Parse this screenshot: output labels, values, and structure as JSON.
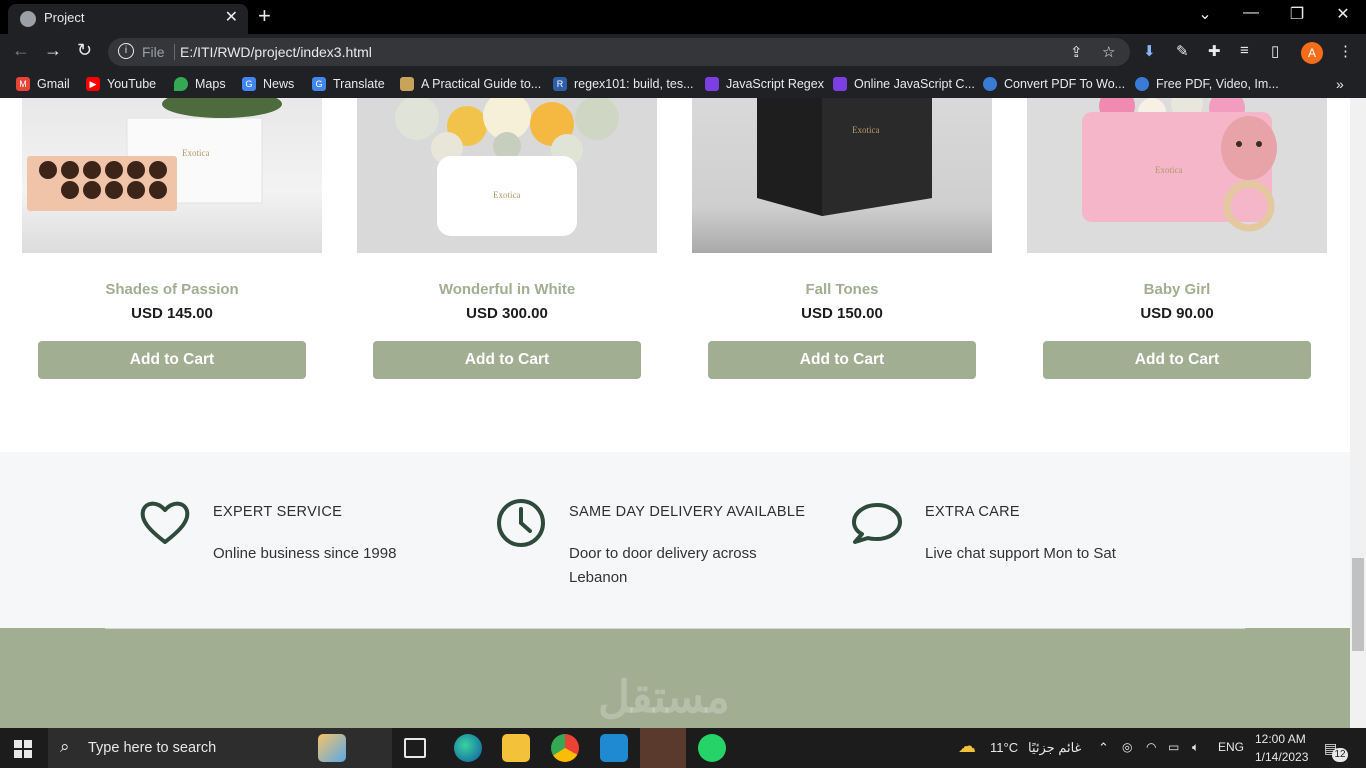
{
  "browser": {
    "tab_title": "Project",
    "url_scheme": "File",
    "url": "E:/ITI/RWD/project/index3.html",
    "profile_initial": "A",
    "bookmarks": [
      {
        "label": "Gmail",
        "icon": "gmail-icon",
        "color": "#ea4335"
      },
      {
        "label": "YouTube",
        "icon": "youtube-icon",
        "color": "#ff0000"
      },
      {
        "label": "Maps",
        "icon": "maps-icon",
        "color": "#34a853"
      },
      {
        "label": "News",
        "icon": "news-icon",
        "color": "#4285f4"
      },
      {
        "label": "Translate",
        "icon": "translate-icon",
        "color": "#4285f4"
      },
      {
        "label": "A Practical Guide to...",
        "icon": "guide-icon",
        "color": "#c8a35a"
      },
      {
        "label": "regex101: build, tes...",
        "icon": "regex101-icon",
        "color": "#2f5ea8"
      },
      {
        "label": "JavaScript Regex",
        "icon": "js-regex-icon",
        "color": "#7b3fe4"
      },
      {
        "label": "Online JavaScript C...",
        "icon": "online-js-icon",
        "color": "#7b3fe4"
      },
      {
        "label": "Convert PDF To Wo...",
        "icon": "pdf-icon",
        "color": "#3a7bd5"
      },
      {
        "label": "Free PDF, Video, Im...",
        "icon": "free-pdf-icon",
        "color": "#3a7bd5"
      }
    ]
  },
  "products": [
    {
      "name": "Shades of Passion",
      "price": "USD 145.00",
      "button": "Add to Cart"
    },
    {
      "name": "Wonderful in White",
      "price": "USD 300.00",
      "button": "Add to Cart"
    },
    {
      "name": "Fall Tones",
      "price": "USD 150.00",
      "button": "Add to Cart"
    },
    {
      "name": "Baby Girl",
      "price": "USD 90.00",
      "button": "Add to Cart"
    }
  ],
  "image_text": {
    "brand_on_box": "Exotica"
  },
  "features": [
    {
      "title": "EXPERT SERVICE",
      "desc": "Online business since 1998",
      "icon": "heart-icon"
    },
    {
      "title": "SAME DAY DELIVERY AVAILABLE",
      "desc": "Door to door delivery across Lebanon",
      "icon": "clock-icon"
    },
    {
      "title": "EXTRA CARE",
      "desc": "Live chat support Mon to Sat",
      "icon": "chat-icon"
    }
  ],
  "watermark": "مستقل",
  "taskbar": {
    "search_placeholder": "Type here to search",
    "weather_temp": "11°C",
    "weather_text": "غائم جزئيًا",
    "language": "ENG",
    "time": "12:00 AM",
    "date": "1/14/2023",
    "notifications": "12"
  },
  "colors": {
    "accent": "#a2ae92",
    "icon_dark": "#2e4a3a",
    "features_bg": "#f6f7f8"
  }
}
